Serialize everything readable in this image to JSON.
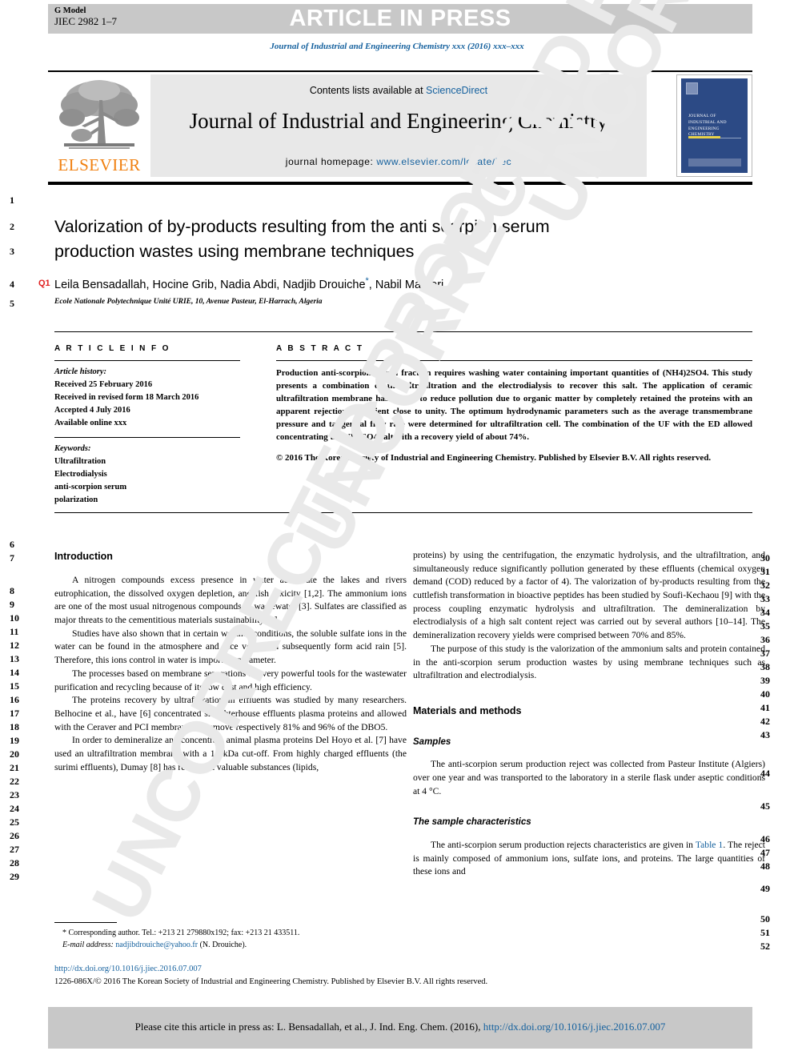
{
  "header": {
    "g_model_label": "G Model",
    "g_model_id": "JIEC 2982 1–7",
    "article_in_press": "ARTICLE IN PRESS",
    "journal_reference": "Journal of Industrial and Engineering Chemistry xxx (2016) xxx–xxx"
  },
  "masthead": {
    "contents_prefix": "Contents lists available at ",
    "sciencedirect": "ScienceDirect",
    "journal_title": "Journal of Industrial and Engineering Chemistry",
    "homepage_prefix": "journal homepage: ",
    "homepage_url": "www.elsevier.com/locate/jiec",
    "publisher": "ELSEVIER",
    "cover_title": "Journal of Industrial and Engineering Chemistry",
    "accent_blue": "#15619e",
    "elsevier_orange": "#f08010",
    "cover_blue": "#2c4a85"
  },
  "article": {
    "title": "Valorization of by-products resulting from the anti scorpion serum production wastes using membrane techniques",
    "query_flag": "Q1",
    "authors": "Leila Bensadallah, Hocine Grib, Nadia Abdi, Nadjib Drouiche",
    "authors_tail": ", Nabil Mameri",
    "affiliation": "Ecole Nationale Polytechnique Unité URIE, 10, Avenue Pasteur, El-Harrach, Algeria"
  },
  "article_info": {
    "heading": "A R T I C L E   I N F O",
    "history_label": "Article history:",
    "history": [
      "Received 25 February 2016",
      "Received in revised form 18 March 2016",
      "Accepted 4 July 2016",
      "Available online xxx"
    ],
    "keywords_label": "Keywords:",
    "keywords": [
      "Ultrafiltration",
      "Electrodialysis",
      "anti-scorpion serum",
      "polarization"
    ]
  },
  "abstract": {
    "heading": "A B S T R A C T",
    "body": "Production anti-scorpion serum fraction requires washing water containing important quantities of (NH4)2SO4. This study presents a combination of the ultrafiltration and the electrodialysis to recover this salt. The application of ceramic ultrafiltration membrane has helped to reduce pollution due to organic matter by completely retained the proteins with an apparent rejection coefficient close to unity. The optimum hydrodynamic parameters such as the average transmembrane pressure and tangential flow rate were determined for ultrafiltration cell. The combination of the UF with the ED allowed concentrating the NH4SO4 salt with a recovery yield of about 74%.",
    "copyright": "© 2016 The Korean Society of Industrial and Engineering Chemistry. Published by Elsevier B.V. All rights reserved."
  },
  "body": {
    "left_heading": "Introduction",
    "left_paragraphs": [
      "A nitrogen compounds excess presence in water accelerate the lakes and rivers eutrophication, the dissolved oxygen depletion, and fish toxicity [1,2]. The ammonium ions are one of the most usual nitrogenous compounds in wastewater [3]. Sulfates are classified as major threats to the cementitious materials sustainability [4].",
      "Studies have also shown that in certain weather conditions, the soluble sulfate ions in the water can be found in the atmosphere and vice versa and subsequently form acid rain [5]. Therefore, this ions control in water is important parameter.",
      "The processes based on membrane separations are very powerful tools for the wastewater purification and recycling because of its low cost and high efficiency.",
      "The proteins recovery by ultrafiltration in effluents was studied by many researchers. Belhocine et al., have [6] concentrated slaughterhouse effluents plasma proteins and allowed with the Ceraver and PCI membranes to remove respectively 81% and 96% of the DBO5.",
      "In order to demineralize and concentrate animal plasma proteins Del Hoyo et al. [7] have used an ultrafiltration membrane with a 10 kDa cut-off. From highly charged effluents (the surimi effluents), Dumay [8] has recovered valuable substances (lipids,"
    ],
    "right_paragraph_continued": "proteins) by using the centrifugation, the enzymatic hydrolysis, and the ultrafiltration, and simultaneously reduce significantly pollution generated by these effluents (chemical oxygen demand (COD) reduced by a factor of 4). The valorization of by-products resulting from the cuttlefish transformation in bioactive peptides has been studied by Soufi-Kechaou [9] with the process coupling enzymatic hydrolysis and ultrafiltration. The demineralization by electrodialysis of a high salt content reject was carried out by several authors [10–14]. The demineralization recovery yields were comprised between 70% and 85%.",
    "right_paragraph_purpose": "The purpose of this study is the valorization of the ammonium salts and protein contained in the anti-scorpion serum production wastes by using membrane techniques such as ultrafiltration and electrodialysis.",
    "materials_heading": "Materials and methods",
    "samples_heading": "Samples",
    "samples_paragraph": "The anti-scorpion serum production reject was collected from Pasteur Institute (Algiers) over one year and was transported to the laboratory in a sterile flask under aseptic conditions at 4 °C.",
    "sample_characteristics_heading": "The sample characteristics",
    "sample_characteristics_paragraph_pre": "The anti-scorpion serum production rejects characteristics are given in ",
    "sample_characteristics_link": "Table 1",
    "sample_characteristics_paragraph_post": ". The reject is mainly composed of ammonium ions, sulfate ions, and proteins. The large quantities of these ions and"
  },
  "line_numbers": {
    "title_block": [
      "1",
      "2",
      "3",
      "4",
      "5"
    ],
    "left_column": [
      "6",
      "7",
      "8",
      "9",
      "10",
      "11",
      "12",
      "13",
      "14",
      "15",
      "16",
      "17",
      "18",
      "19",
      "20",
      "21",
      "22",
      "23",
      "24",
      "25",
      "26",
      "27",
      "28",
      "29"
    ],
    "right_column": [
      "30",
      "31",
      "32",
      "33",
      "34",
      "35",
      "36",
      "37",
      "38",
      "39",
      "40",
      "41",
      "42",
      "43",
      "44",
      "45",
      "46",
      "47",
      "48",
      "49",
      "50",
      "51",
      "52"
    ]
  },
  "footnote": {
    "corresponding": "* Corresponding author. Tel.: +213 21 279880x192; fax: +213 21 433511.",
    "email_label": "E-mail address: ",
    "email": "nadjibdrouiche@yahoo.fr",
    "email_suffix": " (N. Drouiche).",
    "doi": "http://dx.doi.org/10.1016/j.jiec.2016.07.007",
    "issn_line": "1226-086X/© 2016 The Korean Society of Industrial and Engineering Chemistry. Published by Elsevier B.V. All rights reserved."
  },
  "cite_box": {
    "prefix": "Please cite this article in press as: L. Bensadallah, et al., J. Ind. Eng. Chem. (2016), ",
    "link": "http://dx.doi.org/10.1016/j.jiec.2016.07.007"
  },
  "watermark": {
    "line1": "UNCORRECTED PROOF",
    "line2": "UNCORRECTED PROOF",
    "line3": "UNCORRECTED PROOF"
  }
}
